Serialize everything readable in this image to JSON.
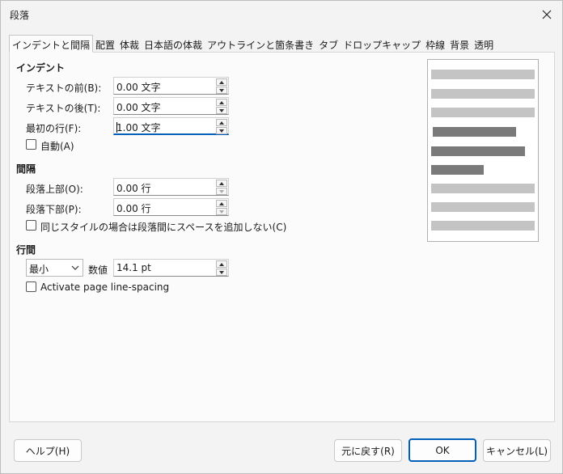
{
  "window": {
    "title": "段落"
  },
  "tabs": [
    {
      "label": "インデントと間隔",
      "active": true
    },
    {
      "label": "配置"
    },
    {
      "label": "体裁"
    },
    {
      "label": "日本語の体裁"
    },
    {
      "label": "アウトラインと箇条書き"
    },
    {
      "label": "タブ"
    },
    {
      "label": "ドロップキャップ"
    },
    {
      "label": "枠線"
    },
    {
      "label": "背景"
    },
    {
      "label": "透明"
    }
  ],
  "indent": {
    "title": "インデント",
    "before_label": "テキストの前(B):",
    "before_value": "0.00 文字",
    "after_label": "テキストの後(T):",
    "after_value": "0.00 文字",
    "first_label": "最初の行(F):",
    "first_value": "1.00 文字",
    "auto_label": "自動(A)",
    "auto_checked": false
  },
  "spacing": {
    "title": "間隔",
    "above_label": "段落上部(O):",
    "above_value": "0.00 行",
    "below_label": "段落下部(P):",
    "below_value": "0.00 行",
    "contextual_label": "同じスタイルの場合は段落間にスペースを追加しない(C)",
    "contextual_checked": false
  },
  "line_spacing": {
    "title": "行間",
    "mode": "最小",
    "value_label": "数値",
    "value": "14.1 pt",
    "page_line_spacing_label": "Activate page line-spacing",
    "page_line_spacing_checked": false
  },
  "buttons": {
    "help": "ヘルプ(H)",
    "reset": "元に戻す(R)",
    "ok": "OK",
    "cancel": "キャンセル(L)"
  },
  "colors": {
    "accent": "#005fb8",
    "preview_light": "#c4c4c4",
    "preview_dark": "#7a7a7a"
  }
}
